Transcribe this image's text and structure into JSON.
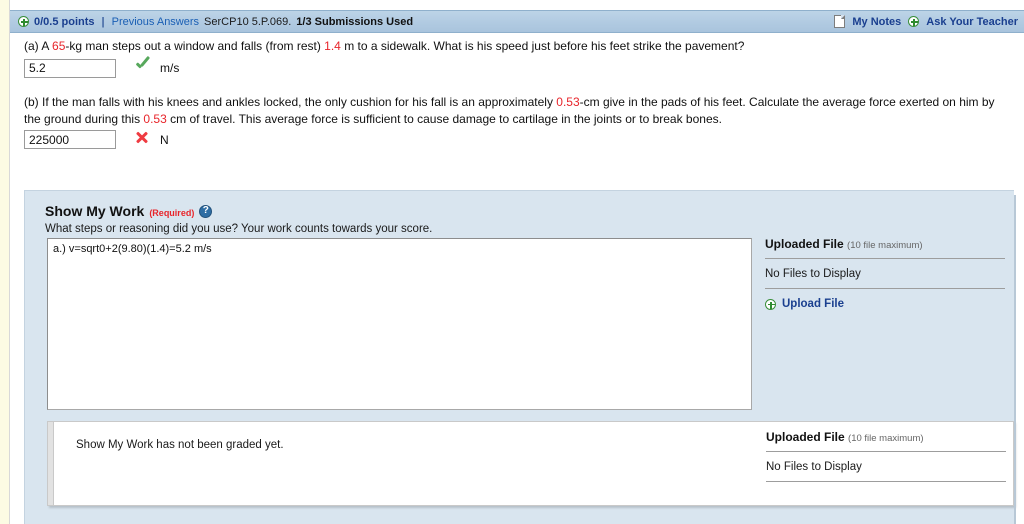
{
  "header": {
    "points": "0/0.5 points",
    "separator": "|",
    "previous_answers": "Previous Answers",
    "question_code": "SerCP10 5.P.069.",
    "submissions_used": "1/3 Submissions Used",
    "my_notes": "My Notes",
    "ask_your_teacher": "Ask Your Teacher",
    "plus_icon": "plus-circle-icon",
    "notes_icon": "page-icon",
    "accent_blue": "#1a3f8f",
    "bar_background": "#b2cbe2"
  },
  "questions": {
    "a": {
      "label": "(a)",
      "text_1": " A ",
      "value_1": "65",
      "text_2": "-kg man steps out a window and falls (from rest) ",
      "value_2": "1.4",
      "text_3": " m to a sidewalk. What is his speed just before his feet strike the pavement?",
      "answer_value": "5.2",
      "answer_unit": "m/s",
      "status": "correct",
      "status_icon": "green-check-icon"
    },
    "b": {
      "label": "(b)",
      "text_1": " If the man falls with his knees and ankles locked, the only cushion for his fall is an approximately ",
      "value_1": "0.53",
      "text_2": "-cm give in the pads of his feet. Calculate the average force exerted on him by the ground during this ",
      "value_2": "0.53",
      "text_3": " cm of travel. This average force is sufficient to cause damage to cartilage in the joints or to break bones.",
      "answer_value": "225000",
      "answer_unit": "N",
      "status": "incorrect",
      "status_icon": "red-x-icon"
    }
  },
  "show_my_work": {
    "title": "Show My Work",
    "required_label": "(Required)",
    "help_icon": "question-mark-help-icon",
    "prompt": "What steps or reasoning did you use? Your work counts towards your score.",
    "work_text": "a.) v=sqrt0+2(9.80)(1.4)=5.2 m/s",
    "upload": {
      "heading": "Uploaded File",
      "max_note": "(10 file maximum)",
      "empty_text": "No Files to Display",
      "upload_link": "Upload File",
      "upload_icon": "green-plus-circle-icon"
    },
    "graded": {
      "status_text": "Show My Work has not been graded yet.",
      "upload": {
        "heading": "Uploaded File",
        "max_note": "(10 file maximum)",
        "empty_text": "No Files to Display"
      }
    },
    "panel_background": "#d9e5ef"
  },
  "colors": {
    "red_value": "#e8252b",
    "link_blue": "#1a5fb4",
    "check_green": "#57a85c",
    "x_red": "#ef3b41",
    "gutter_cream": "#fcfbe3"
  }
}
